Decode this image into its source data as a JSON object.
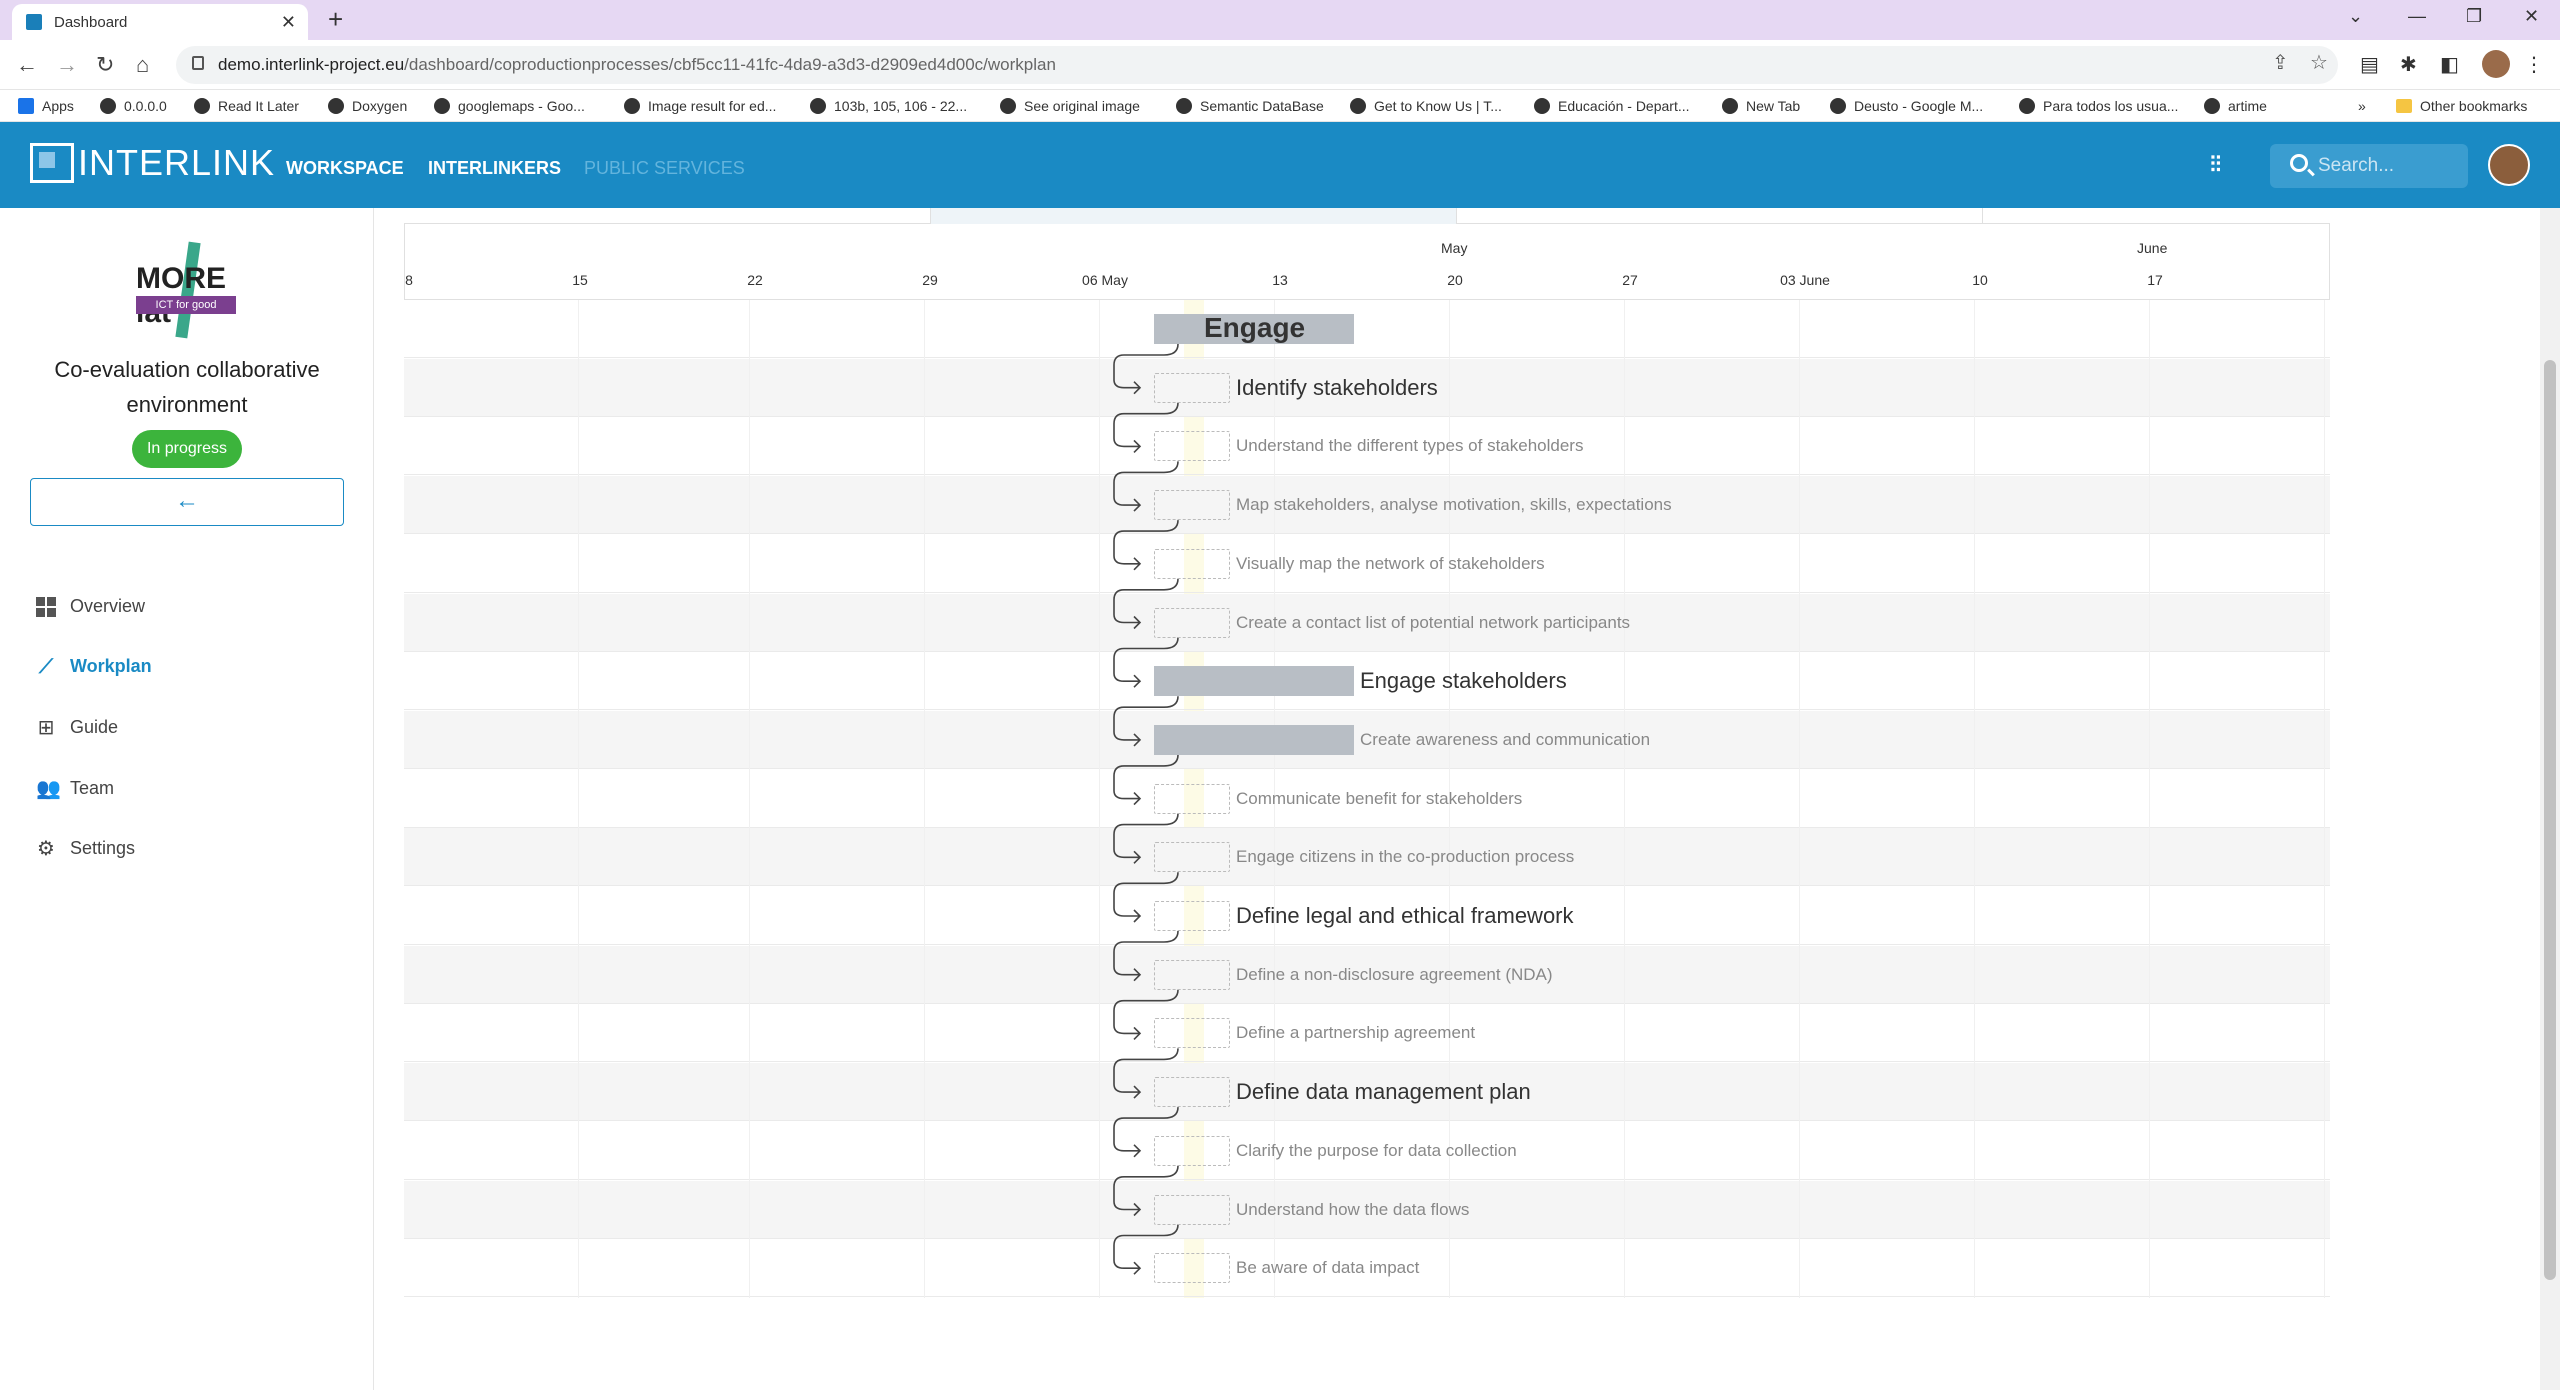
{
  "browser": {
    "tab_title": "Dashboard",
    "url_domain": "demo.interlink-project.eu",
    "url_path": "/dashboard/coproductionprocesses/cbf5cc11-41fc-4da9-a3d3-d2909ed4d00c/workplan",
    "bookmarks": [
      "Apps",
      "0.0.0.0",
      "Read It Later",
      "Doxygen",
      "googlemaps - Goo...",
      "Image result for ed...",
      "103b, 105, 106 - 22...",
      "See original image",
      "Semantic DataBase",
      "Get to Know Us | T...",
      "Educación - Depart...",
      "New Tab",
      "Deusto - Google M...",
      "Para todos los usua...",
      "artime"
    ],
    "other_bookmarks": "Other bookmarks",
    "overflow": "»"
  },
  "appbar": {
    "logo_text": "INTERLINK",
    "nav": [
      "WORKSPACE",
      "INTERLINKERS",
      "PUBLIC SERVICES"
    ],
    "search_placeholder": "Search..."
  },
  "sidebar": {
    "logo_text": "MORE lat",
    "logo_tagline": "ICT for good",
    "project_title": "Co-evaluation collaborative environment",
    "status": "In progress",
    "back_glyph": "←",
    "menu": [
      {
        "label": "Overview",
        "icon": "dashboard-icon"
      },
      {
        "label": "Workplan",
        "icon": "timeline-icon"
      },
      {
        "label": "Guide",
        "icon": "account-tree-icon"
      },
      {
        "label": "Team",
        "icon": "group-icon"
      },
      {
        "label": "Settings",
        "icon": "gear-icon"
      }
    ],
    "active_item": "Workplan"
  },
  "timeline": {
    "months": [
      "May",
      "June"
    ],
    "days": [
      "8",
      "15",
      "22",
      "29",
      "06 May",
      "13",
      "20",
      "27",
      "03 June",
      "10",
      "17"
    ]
  },
  "tasks": [
    {
      "name": "Engage",
      "level": "phase",
      "bar": "filled"
    },
    {
      "name": "Identify stakeholders",
      "level": "objective",
      "bar": "dashed"
    },
    {
      "name": "Understand the different types of stakeholders",
      "level": "task",
      "bar": "dashed"
    },
    {
      "name": "Map stakeholders, analyse motivation, skills, expectations",
      "level": "task",
      "bar": "dashed"
    },
    {
      "name": "Visually map the network of stakeholders",
      "level": "task",
      "bar": "dashed"
    },
    {
      "name": "Create a contact list of potential network participants",
      "level": "task",
      "bar": "dashed"
    },
    {
      "name": "Engage stakeholders",
      "level": "objective",
      "bar": "filled"
    },
    {
      "name": "Create awareness and communication",
      "level": "task",
      "bar": "filled"
    },
    {
      "name": "Communicate benefit for stakeholders",
      "level": "task",
      "bar": "dashed"
    },
    {
      "name": "Engage citizens in the co-production process",
      "level": "task",
      "bar": "dashed"
    },
    {
      "name": "Define legal and ethical framework",
      "level": "objective",
      "bar": "dashed"
    },
    {
      "name": "Define a non-disclosure agreement (NDA)",
      "level": "task",
      "bar": "dashed"
    },
    {
      "name": "Define a partnership agreement",
      "level": "task",
      "bar": "dashed"
    },
    {
      "name": "Define data management plan",
      "level": "objective",
      "bar": "dashed"
    },
    {
      "name": "Clarify the purpose for data collection",
      "level": "task",
      "bar": "dashed"
    },
    {
      "name": "Understand how the data flows",
      "level": "task",
      "bar": "dashed"
    },
    {
      "name": "Be aware of data impact",
      "level": "task",
      "bar": "dashed"
    }
  ]
}
